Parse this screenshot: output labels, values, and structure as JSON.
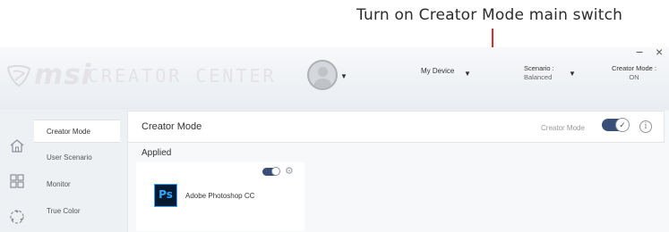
{
  "callout": {
    "text": "Turn on Creator Mode main switch"
  },
  "window": {
    "minimize": "−",
    "close": "×"
  },
  "brand": {
    "logo_text": "msi",
    "app_name": "CREATOR CENTER"
  },
  "topbar": {
    "device_label": "My Device",
    "scenario_label": "Scenario :",
    "scenario_value": "Balanced",
    "creator_label": "Creator Mode :",
    "creator_value": "ON",
    "caret": "▼"
  },
  "sidebar": {
    "items": [
      {
        "label": "Creator Mode",
        "icon": "home-icon",
        "active": true
      },
      {
        "label": "User Scenario",
        "icon": "",
        "active": false
      },
      {
        "label": "Monitor",
        "icon": "grid-icon",
        "active": false
      },
      {
        "label": "True Color",
        "icon": "color-wheel-icon",
        "active": false
      }
    ]
  },
  "main": {
    "title": "Creator Mode",
    "toggle_label": "Creator Mode",
    "toggle_on": true,
    "info_glyph": "i",
    "applied_label": "Applied",
    "apps": [
      {
        "name": "Adobe Photoshop CC",
        "icon_text": "Ps",
        "enabled": true
      }
    ]
  },
  "colors": {
    "accent": "#3a4f78",
    "callout_line": "#e8272a",
    "ps_blue": "#31a8ff",
    "ps_bg": "#051a30"
  }
}
